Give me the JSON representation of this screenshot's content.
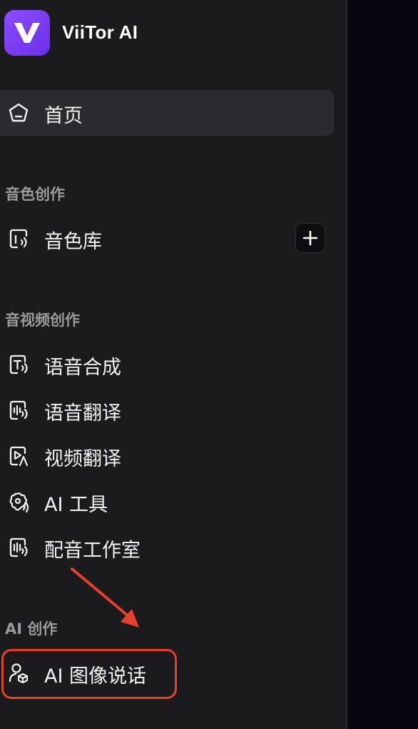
{
  "app": {
    "title": "ViiTor AI",
    "logo_letter": "V",
    "brand_color": "#7b3ff2"
  },
  "nav": {
    "home": {
      "label": "首页",
      "icon": "home-icon",
      "active": true
    },
    "sections": [
      {
        "title": "音色创作",
        "items": [
          {
            "label": "音色库",
            "icon": "voice-library-icon",
            "has_add_button": true
          }
        ]
      },
      {
        "title": "音视频创作",
        "items": [
          {
            "label": "语音合成",
            "icon": "text-to-speech-icon"
          },
          {
            "label": "语音翻译",
            "icon": "voice-translate-icon"
          },
          {
            "label": "视频翻译",
            "icon": "video-translate-icon"
          },
          {
            "label": "AI 工具",
            "icon": "ai-tools-icon"
          },
          {
            "label": "配音工作室",
            "icon": "dubbing-studio-icon"
          }
        ]
      },
      {
        "title": "AI 创作",
        "items": [
          {
            "label": "AI 图像说话",
            "icon": "talking-image-icon"
          }
        ]
      }
    ]
  },
  "annotation": {
    "highlight_color": "#e5402f",
    "target": "AI 图像说话"
  }
}
